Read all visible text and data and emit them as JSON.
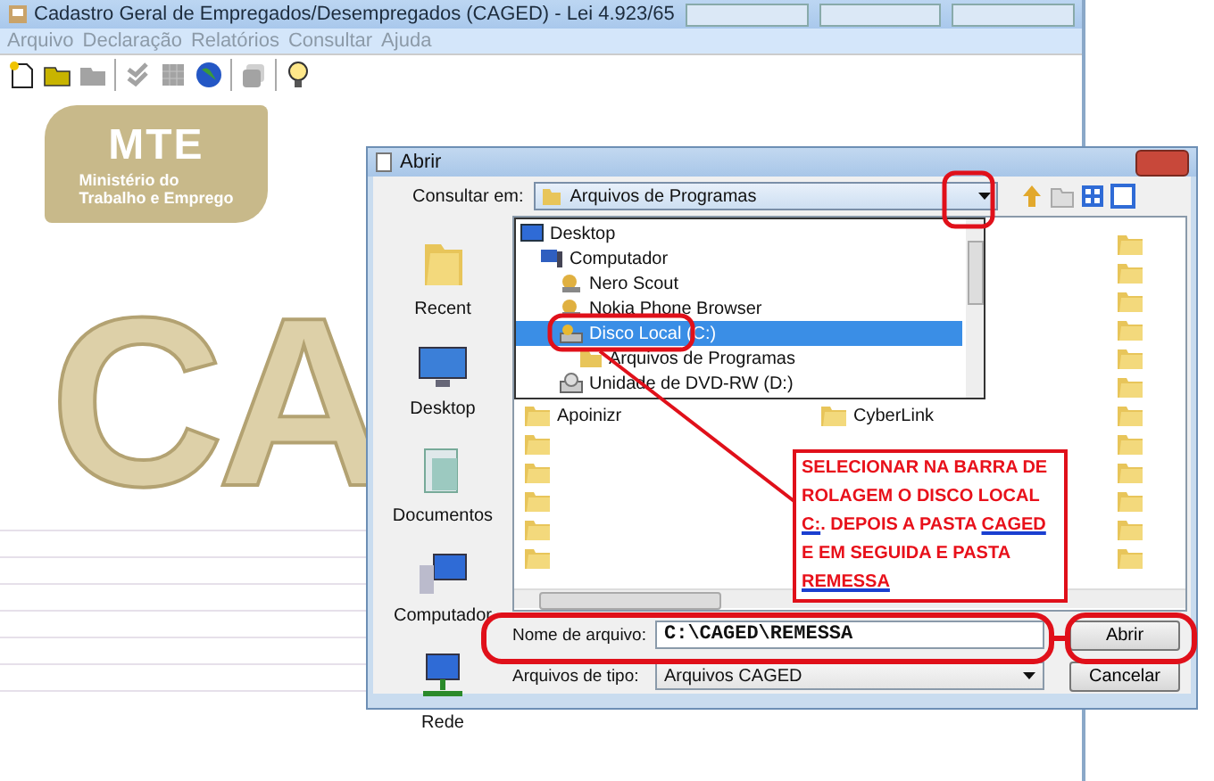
{
  "app_window": {
    "title": "Cadastro Geral de Empregados/Desempregados (CAGED) - Lei 4.923/65",
    "menu": [
      "Arquivo",
      "Declaração",
      "Relatórios",
      "Consultar",
      "Ajuda"
    ],
    "toolbar": [
      {
        "kind": "new",
        "disabled": false
      },
      {
        "kind": "open",
        "disabled": false
      },
      {
        "kind": "folder",
        "disabled": true
      },
      {
        "kind": "check",
        "disabled": true
      },
      {
        "kind": "grid",
        "disabled": true
      },
      {
        "kind": "globe",
        "disabled": false
      },
      {
        "kind": "stack",
        "disabled": true
      },
      {
        "kind": "bulb",
        "disabled": false
      }
    ],
    "logo": {
      "abbr": "MTE",
      "lines": [
        "Ministério do",
        "Trabalho e Emprego"
      ]
    },
    "banner": "CA"
  },
  "open_dialog": {
    "title": "Abrir",
    "look_in": {
      "label": "Consultar em:",
      "value": "Arquivos de Programas",
      "options": [
        {
          "label": "Desktop",
          "kind": "desktop",
          "selected": false,
          "children": [
            {
              "label": "Computador",
              "kind": "computer",
              "selected": false,
              "children": [
                {
                  "label": "Nero Scout",
                  "kind": "app",
                  "selected": false
                },
                {
                  "label": "Nokia Phone Browser",
                  "kind": "app",
                  "selected": false
                },
                {
                  "label": "Disco Local (C:)",
                  "kind": "drive",
                  "selected": true,
                  "children": [
                    {
                      "label": "Arquivos de Programas",
                      "kind": "folder",
                      "selected": false
                    }
                  ]
                },
                {
                  "label": "Unidade de DVD-RW (D:)",
                  "kind": "dvd",
                  "selected": false
                }
              ]
            }
          ]
        }
      ]
    },
    "places": [
      {
        "label": "Recent",
        "kind": "recent"
      },
      {
        "label": "Desktop",
        "kind": "desktop"
      },
      {
        "label": "Documentos",
        "kind": "documents"
      },
      {
        "label": "Computador",
        "kind": "computer"
      },
      {
        "label": "Rede",
        "kind": "network"
      }
    ],
    "files": [
      {
        "name": "Apoinizr"
      },
      {
        "name": "CyberLink"
      }
    ],
    "file_name": {
      "label": "Nome de arquivo:",
      "value": "C:\\CAGED\\REMESSA"
    },
    "file_type": {
      "label": "Arquivos de tipo:",
      "value": "Arquivos CAGED"
    },
    "buttons": [
      "Abrir",
      "Cancelar"
    ]
  },
  "callout": {
    "parts": [
      {
        "text": "SELECIONAR NA BARRA DE ROLAGEM O DISCO LOCAL ",
        "underlined": false
      },
      {
        "text": "C:",
        "underlined": true
      },
      {
        "text": ". DEPOIS A PASTA ",
        "underlined": false
      },
      {
        "text": "CAGED",
        "underlined": true
      },
      {
        "text": " E EM SEGUIDA E PASTA ",
        "underlined": false
      },
      {
        "text": "REMESSA",
        "underlined": true
      }
    ]
  }
}
